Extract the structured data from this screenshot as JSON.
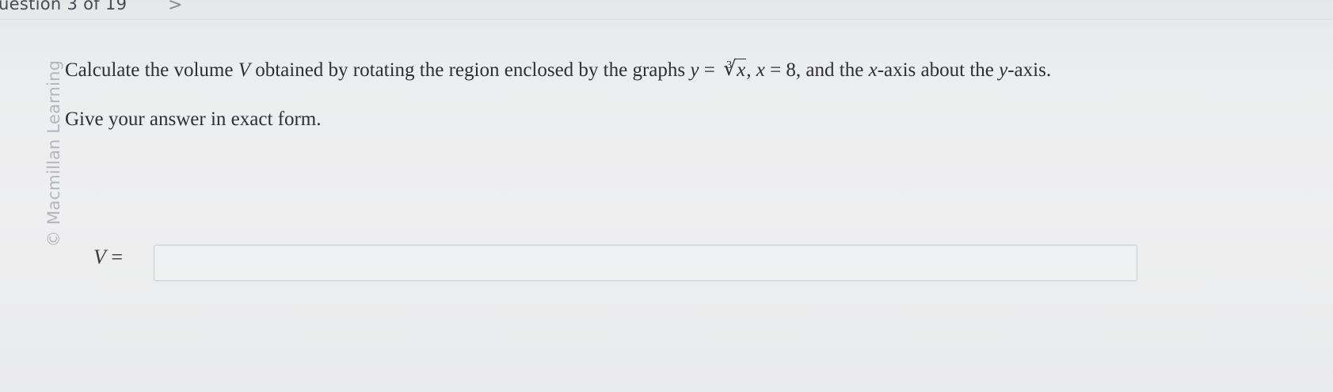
{
  "header": {
    "question_counter": "uestion 3 of 19",
    "next_arrow": ">"
  },
  "watermark": "© Macmillan Learning",
  "question": {
    "text_1": "Calculate the volume ",
    "var_V": "V",
    "text_2": " obtained by rotating the region enclosed by the graphs ",
    "var_y": "y",
    "eq": " = ",
    "root_index": "3",
    "root_sign": "√",
    "root_radicand": "x",
    "text_3": ", ",
    "var_x": "x",
    "text_4": " = 8, and the ",
    "var_x2": "x",
    "text_5": "-axis about the ",
    "var_y2": "y",
    "text_6": "-axis."
  },
  "instruction": "Give your answer in exact form.",
  "answer": {
    "label_var": "V",
    "label_eq": " =",
    "value": ""
  }
}
